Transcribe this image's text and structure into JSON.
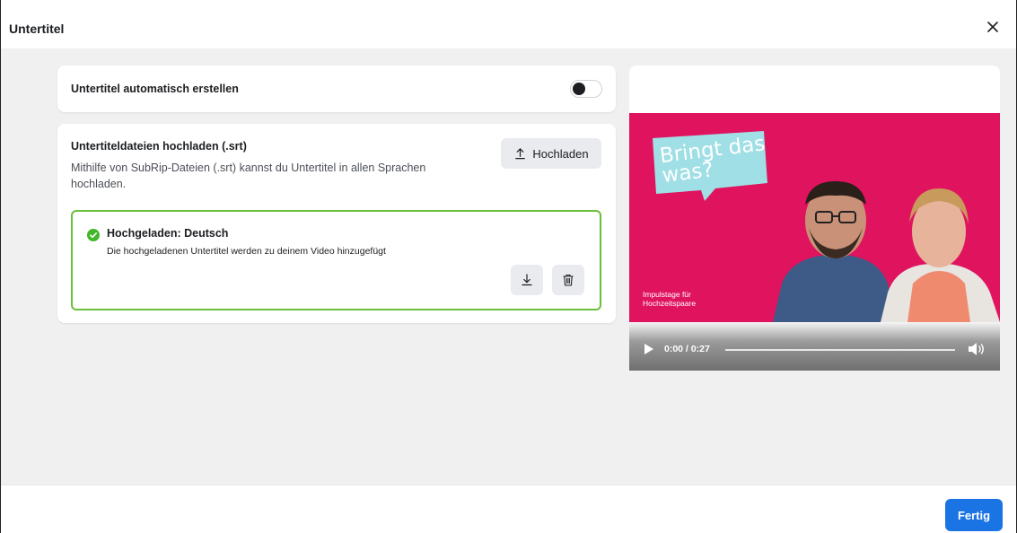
{
  "dialog": {
    "title": "Untertitel",
    "close_icon": "close-icon"
  },
  "auto_subtitles": {
    "label": "Untertitel automatisch erstellen",
    "toggle_on": false
  },
  "upload": {
    "title": "Untertiteldateien hochladen (.srt)",
    "description": "Mithilfe von SubRip-Dateien (.srt) kannst du Untertitel in allen Sprachen hochladen.",
    "button_label": "Hochladen"
  },
  "uploaded_file": {
    "title": "Hochgeladen: Deutsch",
    "description": "Die hochgeladenen Untertitel werden zu deinem Video hinzugefügt",
    "status_color": "#6bbf3a"
  },
  "video": {
    "bubble_text": "Bringt das was?",
    "caption": "Impulstage für Hochzeitspaare",
    "time": "0:00 / 0:27",
    "background_color": "#e0135f"
  },
  "footer": {
    "done_label": "Fertig",
    "accent_color": "#1b74e4"
  }
}
